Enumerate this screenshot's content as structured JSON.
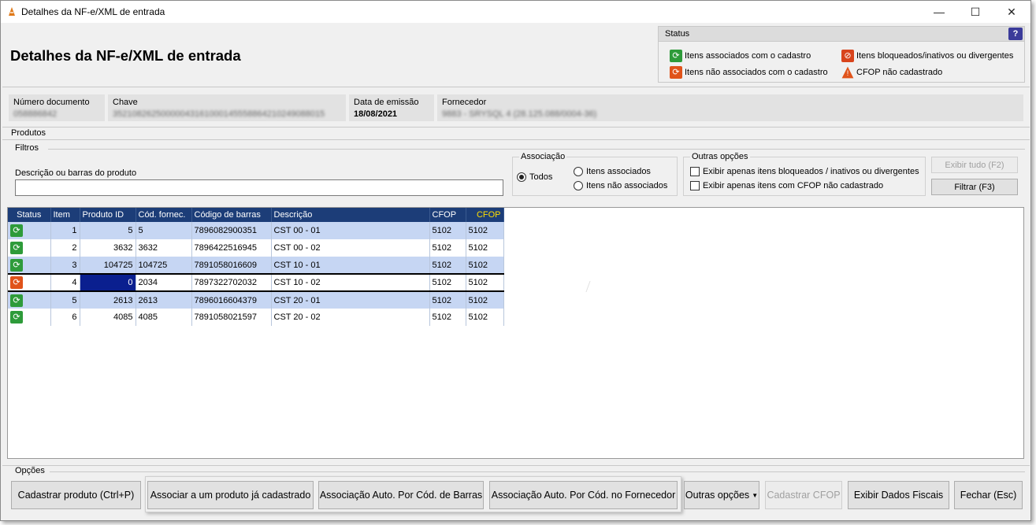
{
  "window": {
    "title": "Detalhes da NF-e/XML de entrada",
    "controls": [
      "—",
      "☐",
      "✕"
    ]
  },
  "header": {
    "title": "Detalhes da NF-e/XML de entrada"
  },
  "status": {
    "title": "Status",
    "help": "?",
    "legend": [
      {
        "icon": "sync-green-icon",
        "label": "Itens associados com o cadastro"
      },
      {
        "icon": "blocked-icon",
        "label": "Itens bloqueados/inativos ou divergentes"
      },
      {
        "icon": "sync-orange-icon",
        "label": "Itens não associados com o cadastro"
      },
      {
        "icon": "warning-icon",
        "label": "CFOP não cadastrado"
      }
    ]
  },
  "info": {
    "numero_label": "Número documento",
    "numero_value": "058886842",
    "chave_label": "Chave",
    "chave_value": "35210826250000043161000145558864210249088015",
    "data_label": "Data de emissão",
    "data_value": "18/08/2021",
    "fornecedor_label": "Fornecedor",
    "fornecedor_value": "9883 - SRYSQL 4 (28.125.088/0004-36)"
  },
  "produtos": {
    "label": "Produtos",
    "filtros_label": "Filtros",
    "search_label": "Descrição ou barras do produto",
    "search_value": "",
    "associacao_label": "Associação",
    "assoc_todos": "Todos",
    "assoc_associados": "Itens associados",
    "assoc_nao": "Itens não associados",
    "outras_label": "Outras opções",
    "opt_bloqueados": "Exibir apenas itens bloqueados / inativos ou divergentes",
    "opt_cfop": "Exibir apenas itens com CFOP não cadastrado",
    "btn_exibir_tudo": "Exibir tudo (F2)",
    "btn_filtrar": "Filtrar (F3)"
  },
  "grid": {
    "columns": [
      "Status",
      "Item",
      "Produto ID",
      "Cód. fornec.",
      "Código de barras",
      "Descrição",
      "CFOP",
      "CFOP"
    ],
    "rows": [
      {
        "status": "associado",
        "item": "1",
        "produto_id": "5",
        "cod_fornec": "5",
        "barras": "7896082900351",
        "descricao": "CST 00 - 01",
        "cfop1": "5102",
        "cfop2": "5102"
      },
      {
        "status": "associado",
        "item": "2",
        "produto_id": "3632",
        "cod_fornec": "3632",
        "barras": "7896422516945",
        "descricao": "CST 00 - 02",
        "cfop1": "5102",
        "cfop2": "5102"
      },
      {
        "status": "associado",
        "item": "3",
        "produto_id": "104725",
        "cod_fornec": "104725",
        "barras": "7891058016609",
        "descricao": "CST 10 - 01",
        "cfop1": "5102",
        "cfop2": "5102"
      },
      {
        "status": "nao-associado",
        "item": "4",
        "produto_id": "0",
        "cod_fornec": "2034",
        "barras": "7897322702032",
        "descricao": "CST 10 - 02",
        "cfop1": "5102",
        "cfop2": "5102"
      },
      {
        "status": "associado",
        "item": "5",
        "produto_id": "2613",
        "cod_fornec": "2613",
        "barras": "7896016604379",
        "descricao": "CST 20 - 01",
        "cfop1": "5102",
        "cfop2": "5102"
      },
      {
        "status": "associado",
        "item": "6",
        "produto_id": "4085",
        "cod_fornec": "4085",
        "barras": "7891058021597",
        "descricao": "CST 20 - 02",
        "cfop1": "5102",
        "cfop2": "5102"
      }
    ]
  },
  "opcoes": {
    "label": "Opções",
    "cadastrar": "Cadastrar produto (Ctrl+P)",
    "associar": "Associar a um produto já cadastrado",
    "auto_barras": "Associação Auto. Por Cód. de Barras",
    "auto_fornecedor": "Associação Auto. Por Cód. no Fornecedor",
    "outras": "Outras opções",
    "cadastrar_cfop": "Cadastrar CFOP",
    "exibir_fiscais": "Exibir Dados Fiscais",
    "fechar": "Fechar (Esc)"
  },
  "colors": {
    "grid_header": "#1c3d78",
    "grid_alt_row": "#c6d6f3",
    "selection": "#0a1f8f",
    "status_green": "#2e9b3a",
    "status_orange": "#e0531a",
    "cfop_header_yellow": "#ffde00"
  }
}
